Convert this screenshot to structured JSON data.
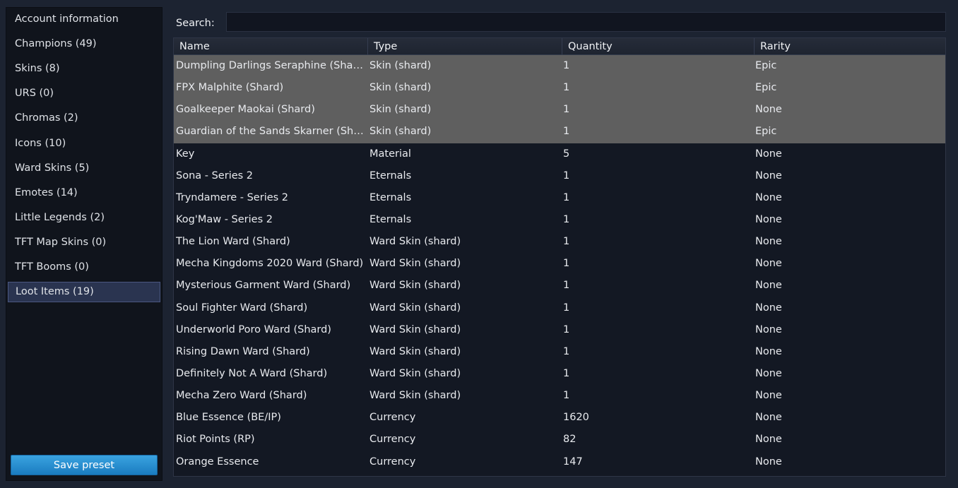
{
  "sidebar": {
    "items": [
      {
        "label": "Account information",
        "active": false
      },
      {
        "label": "Champions (49)",
        "active": false
      },
      {
        "label": "Skins (8)",
        "active": false
      },
      {
        "label": "URS (0)",
        "active": false
      },
      {
        "label": "Chromas (2)",
        "active": false
      },
      {
        "label": "Icons (10)",
        "active": false
      },
      {
        "label": "Ward Skins (5)",
        "active": false
      },
      {
        "label": "Emotes (14)",
        "active": false
      },
      {
        "label": "Little Legends (2)",
        "active": false
      },
      {
        "label": "TFT Map Skins (0)",
        "active": false
      },
      {
        "label": "TFT Booms (0)",
        "active": false
      },
      {
        "label": "Loot Items (19)",
        "active": true
      }
    ],
    "save_label": "Save preset"
  },
  "search": {
    "label": "Search:",
    "value": "",
    "placeholder": ""
  },
  "table": {
    "headers": {
      "name": "Name",
      "type": "Type",
      "quantity": "Quantity",
      "rarity": "Rarity"
    },
    "rows": [
      {
        "name": "Dumpling Darlings Seraphine (Shard)",
        "type": "Skin (shard)",
        "quantity": "1",
        "rarity": "Epic",
        "selected": true
      },
      {
        "name": "FPX Malphite (Shard)",
        "type": "Skin (shard)",
        "quantity": "1",
        "rarity": "Epic",
        "selected": true
      },
      {
        "name": "Goalkeeper Maokai (Shard)",
        "type": "Skin (shard)",
        "quantity": "1",
        "rarity": "None",
        "selected": true
      },
      {
        "name": "Guardian of the Sands Skarner (Shard)",
        "type": "Skin (shard)",
        "quantity": "1",
        "rarity": "Epic",
        "selected": true
      },
      {
        "name": "Key",
        "type": "Material",
        "quantity": "5",
        "rarity": "None",
        "selected": false
      },
      {
        "name": "Sona - Series 2",
        "type": "Eternals",
        "quantity": "1",
        "rarity": "None",
        "selected": false
      },
      {
        "name": "Tryndamere - Series 2",
        "type": "Eternals",
        "quantity": "1",
        "rarity": "None",
        "selected": false
      },
      {
        "name": "Kog'Maw - Series 2",
        "type": "Eternals",
        "quantity": "1",
        "rarity": "None",
        "selected": false
      },
      {
        "name": "The Lion Ward (Shard)",
        "type": "Ward Skin (shard)",
        "quantity": "1",
        "rarity": "None",
        "selected": false
      },
      {
        "name": "Mecha Kingdoms 2020 Ward (Shard)",
        "type": "Ward Skin (shard)",
        "quantity": "1",
        "rarity": "None",
        "selected": false
      },
      {
        "name": "Mysterious Garment Ward (Shard)",
        "type": "Ward Skin (shard)",
        "quantity": "1",
        "rarity": "None",
        "selected": false
      },
      {
        "name": "Soul Fighter Ward (Shard)",
        "type": "Ward Skin (shard)",
        "quantity": "1",
        "rarity": "None",
        "selected": false
      },
      {
        "name": "Underworld Poro Ward (Shard)",
        "type": "Ward Skin (shard)",
        "quantity": "1",
        "rarity": "None",
        "selected": false
      },
      {
        "name": "Rising Dawn Ward (Shard)",
        "type": "Ward Skin (shard)",
        "quantity": "1",
        "rarity": "None",
        "selected": false
      },
      {
        "name": "Definitely Not A Ward (Shard)",
        "type": "Ward Skin (shard)",
        "quantity": "1",
        "rarity": "None",
        "selected": false
      },
      {
        "name": "Mecha Zero Ward (Shard)",
        "type": "Ward Skin (shard)",
        "quantity": "1",
        "rarity": "None",
        "selected": false
      },
      {
        "name": "Blue Essence (BE/IP)",
        "type": "Currency",
        "quantity": "1620",
        "rarity": "None",
        "selected": false
      },
      {
        "name": "Riot Points (RP)",
        "type": "Currency",
        "quantity": "82",
        "rarity": "None",
        "selected": false
      },
      {
        "name": "Orange Essence",
        "type": "Currency",
        "quantity": "147",
        "rarity": "None",
        "selected": false
      }
    ]
  },
  "colors": {
    "background": "#1c2331",
    "sidebar": "#10141c",
    "selected_row": "#5f5f5f",
    "active_nav": "#2a3450",
    "accent_button": "#2a8fd3"
  }
}
